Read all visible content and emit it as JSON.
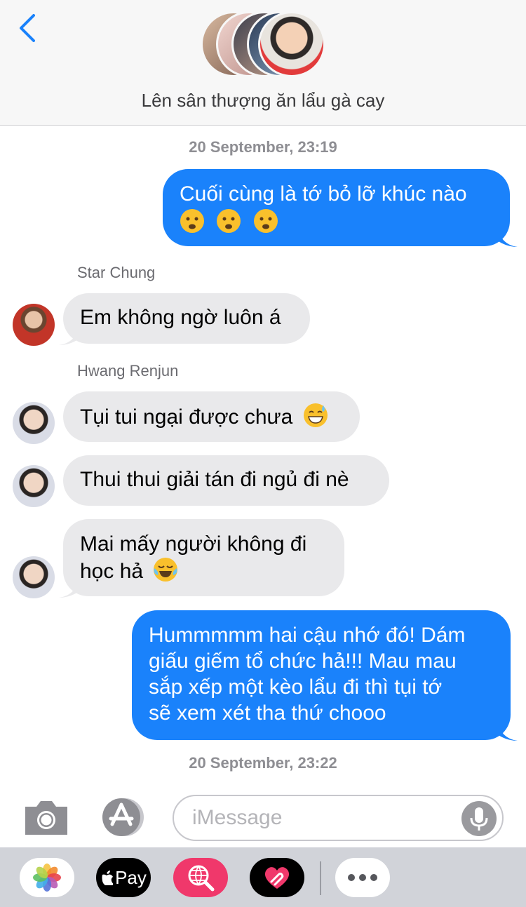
{
  "header": {
    "back_icon": "chevron-left-icon",
    "group_title": "Lên sân thượng ăn lẩu gà cay",
    "accent": "#1a82fb"
  },
  "messages": [
    {
      "type": "timestamp",
      "text": "20 September, 23:19"
    },
    {
      "type": "outgoing",
      "text": "Cuối cùng là tớ bỏ lỡ khúc nào",
      "emoji": [
        "frowning-face",
        "frowning-face",
        "frowning-face"
      ]
    },
    {
      "type": "sender",
      "text": "Star Chung"
    },
    {
      "type": "incoming",
      "text": "Em không ngờ luôn á"
    },
    {
      "type": "sender",
      "text": "Hwang Renjun"
    },
    {
      "type": "incoming",
      "text": "Tụi tui ngại được chưa",
      "emoji": [
        "grinning-sweat"
      ]
    },
    {
      "type": "incoming",
      "text": "Thui thui giải tán đi ngủ đi nè"
    },
    {
      "type": "incoming",
      "lines": [
        "Mai mấy người không đi",
        "học hả"
      ],
      "emoji": [
        "tears-of-joy"
      ]
    },
    {
      "type": "outgoing",
      "lines": [
        "Hummmmm hai cậu nhớ đó! Dám",
        "giấu giếm tổ chức hả!!! Mau mau",
        "sắp xếp một kèo lẩu đi thì tụi tớ",
        "sẽ xem xét tha thứ chooo"
      ]
    },
    {
      "type": "timestamp",
      "text": "20 September, 23:22"
    }
  ],
  "compose": {
    "placeholder": "iMessage",
    "camera_icon": "camera-icon",
    "appstore_icon": "app-store-icon",
    "mic_icon": "microphone-icon"
  },
  "drawer": {
    "apps": [
      {
        "name": "photos-app",
        "label": ""
      },
      {
        "name": "apple-pay-app",
        "label": "Pay"
      },
      {
        "name": "search-images-app",
        "label": ""
      },
      {
        "name": "digital-touch-app",
        "label": ""
      },
      {
        "name": "more-apps",
        "label": ""
      }
    ]
  },
  "colors": {
    "outgoing_bubble": "#1a82fb",
    "incoming_bubble": "#e9e9eb",
    "drawer_bg": "#d1d3d9"
  }
}
